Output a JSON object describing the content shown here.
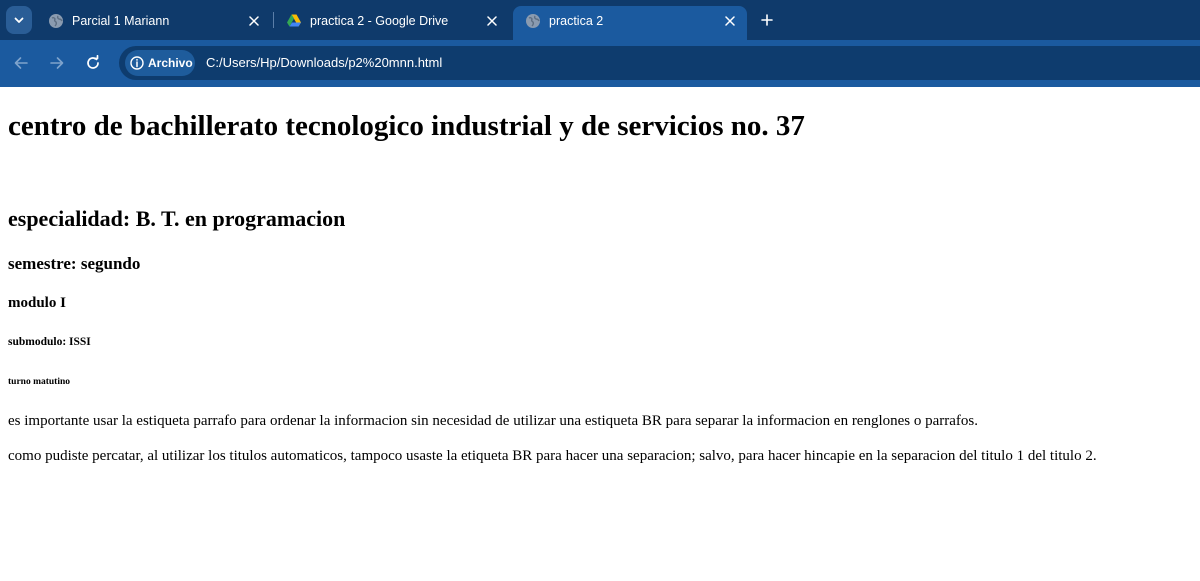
{
  "browser": {
    "tabs": [
      {
        "title": "Parcial 1 Mariann",
        "icon": "globe-icon",
        "active": false
      },
      {
        "title": "practica 2 - Google Drive",
        "icon": "google-drive-icon",
        "active": false
      },
      {
        "title": "practica 2",
        "icon": "globe-icon",
        "active": true
      }
    ],
    "security_chip": "Archivo",
    "url": "C:/Users/Hp/Downloads/p2%20mnn.html",
    "colors": {
      "tabstrip": "#0f3a6b",
      "toolbar": "#1b5a9f",
      "omnibox": "#0e3c6e"
    }
  },
  "page": {
    "h1": "centro de bachillerato tecnologico industrial y de servicios no. 37",
    "h2": "especialidad: B. T. en programacion",
    "h3": "semestre: segundo",
    "h4": "modulo I",
    "h5": "submodulo: ISSI",
    "h6": "turno matutino",
    "paragraphs": [
      "es importante usar la estiqueta parrafo para ordenar la informacion sin necesidad de utilizar una estiqueta BR para separar la informacion en renglones o parrafos.",
      "como pudiste percatar, al utilizar los titulos automaticos, tampoco usaste la etiqueta BR para hacer una separacion; salvo, para hacer hincapie en la separacion del titulo 1 del titulo 2."
    ]
  }
}
